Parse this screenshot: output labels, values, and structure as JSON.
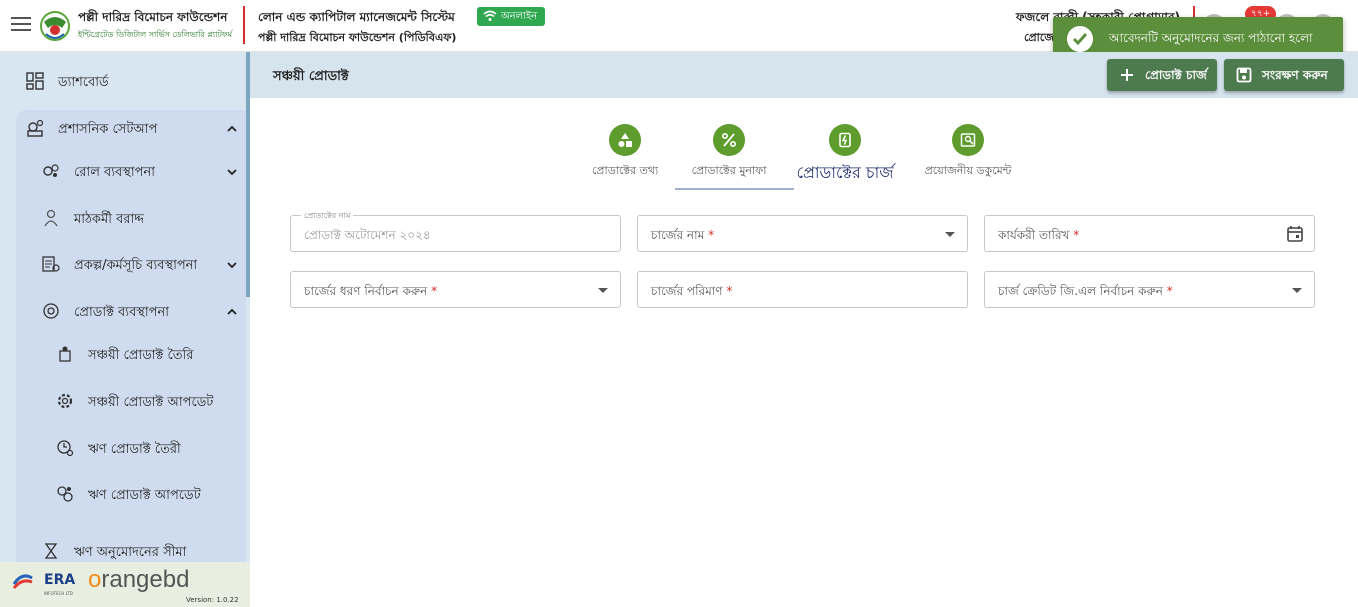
{
  "header": {
    "org_name": "পল্লী দারিদ্র বিমোচন ফাউন্ডেশন",
    "org_tagline": "ইন্টিগ্রেটেড ডিজিটাল সার্ভিস ডেলিভারি প্ল্যাটফর্ম",
    "system_name": "লোন এন্ড ক্যাপিটাল ম্যানেজমেন্ট সিস্টেম",
    "system_sub": "পল্লী দারিদ্র বিমোচন ফাউন্ডেশন (পিডিবিএফ)",
    "online_label": "অনলাইন",
    "user_name": "ফজলে রাব্বী (সহকারী প্রোগ্রামার)",
    "user_project": "প্রোজেক্ট",
    "notification_count": "৭৭+"
  },
  "toast": {
    "message": "আবেদনটি অনুমোদনের জন্য পাঠানো হলো"
  },
  "sidebar": {
    "dashboard": "ড্যাশবোর্ড",
    "admin_setup": "প্রশাসনিক সেটআপ",
    "role_mgmt": "রোল ব্যবস্থাপনা",
    "field_staff": "মাঠকর্মী বরাদ্দ",
    "project_mgmt": "প্রকল্প/কর্মসূচি ব্যবস্থাপনা",
    "product_mgmt": "প্রোডাক্ট ব্যবস্থাপনা",
    "savings_create": "সঞ্চয়ী প্রোডাক্ট তৈরি",
    "savings_update": "সঞ্চয়ী প্রোডাক্ট আপডেট",
    "loan_create": "ঋণ প্রোডাক্ট তৈরী",
    "loan_update": "ঋণ প্রোডাক্ট আপডেট",
    "loan_limit": "ঋণ অনুমোদনের সীমা"
  },
  "footer": {
    "era": "ERA",
    "era_sub": "INFOTECH LTD",
    "brand_o": "o",
    "brand_rest": "rangebd",
    "version": "Version: 1.0.22"
  },
  "page": {
    "title": "সঞ্চয়ী প্রোডাক্ট",
    "btn_charge": "প্রোডাক্ট চার্জ",
    "btn_save": "সংরক্ষণ করুন"
  },
  "steps": [
    {
      "label": "প্রোডাক্টের তথ্য",
      "icon": "shapes-icon"
    },
    {
      "label": "প্রোডাক্টের মুনাফা",
      "icon": "percent-icon"
    },
    {
      "label": "প্রোডাক্টের চার্জ",
      "icon": "charge-icon"
    },
    {
      "label": "প্রয়োজনীয় ডকুমেন্ট",
      "icon": "document-icon"
    }
  ],
  "form": {
    "product_name_label": "প্রোডাক্টের নাম",
    "product_name_value": "প্রোডাক্ট অটোমেশন ২০২৪",
    "charge_name": "চার্জের নাম",
    "effective_date": "কার্যকরী তারিখ",
    "charge_type": "চার্জের ধরণ নির্বাচন করুন",
    "charge_amount": "চার্জের পরিমাণ",
    "charge_gl": "চার্জ ক্রেডিট জি.এল নির্বাচন করুন",
    "required_mark": "*"
  }
}
